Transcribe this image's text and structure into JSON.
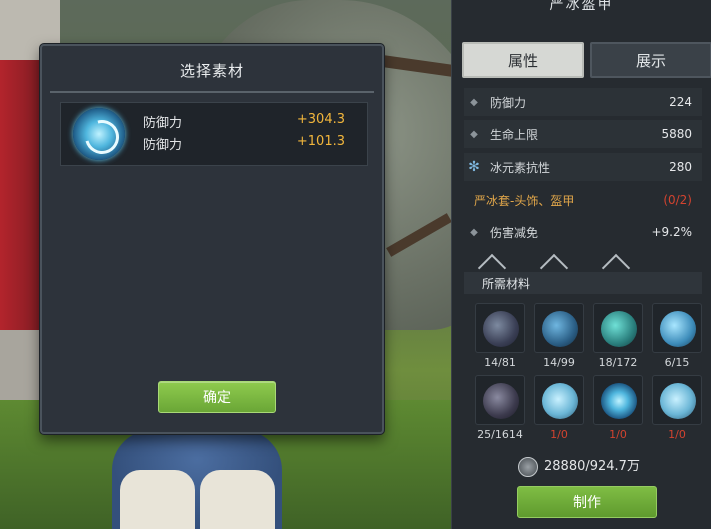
{
  "dialog": {
    "title": "选择素材",
    "material": {
      "icon": "ice-orb-icon",
      "stats": [
        {
          "name": "防御力",
          "value": "+304.3"
        },
        {
          "name": "防御力",
          "value": "+101.3"
        }
      ]
    },
    "confirm_label": "确定"
  },
  "panel": {
    "title": "严冰盔甲",
    "tabs": [
      {
        "label": "属性",
        "selected": true
      },
      {
        "label": "展示",
        "selected": false
      }
    ],
    "attributes": [
      {
        "icon": "diamond-bullet-icon",
        "name": "防御力",
        "value": "224"
      },
      {
        "icon": "diamond-bullet-icon",
        "name": "生命上限",
        "value": "5880"
      },
      {
        "icon": "ice-element-icon",
        "name": "冰元素抗性",
        "value": "280"
      }
    ],
    "set_bonus": {
      "name": "严冰套-头饰、盔甲",
      "value": "(0/2)"
    },
    "damage_reduction": {
      "icon": "diamond-bullet-icon",
      "name": "伤害减免",
      "value": "+9.2%"
    },
    "materials_title": "所需材料",
    "materials": [
      {
        "icon": "dark-claw-icon",
        "count": "14/81",
        "sufficient": true
      },
      {
        "icon": "blue-fang-icon",
        "count": "14/99",
        "sufficient": true
      },
      {
        "icon": "crystal-shard-icon",
        "count": "18/172",
        "sufficient": true
      },
      {
        "icon": "frost-ore-icon",
        "count": "6/15",
        "sufficient": true
      },
      {
        "icon": "shadow-beetle-icon",
        "count": "25/1614",
        "sufficient": true
      },
      {
        "icon": "ice-bubble-icon",
        "count": "1/0",
        "sufficient": false
      },
      {
        "icon": "ice-orb-icon",
        "count": "1/0",
        "sufficient": false
      },
      {
        "icon": "ice-bubble-icon",
        "count": "1/0",
        "sufficient": false
      }
    ],
    "coin": {
      "icon": "coin-icon",
      "text": "28880/924.7万"
    },
    "craft_label": "制作"
  },
  "colors": {
    "accent_green": "#7fbd44",
    "value_gold": "#f2b63c",
    "warning_red": "#d2432f",
    "set_orange": "#e0a64a"
  }
}
